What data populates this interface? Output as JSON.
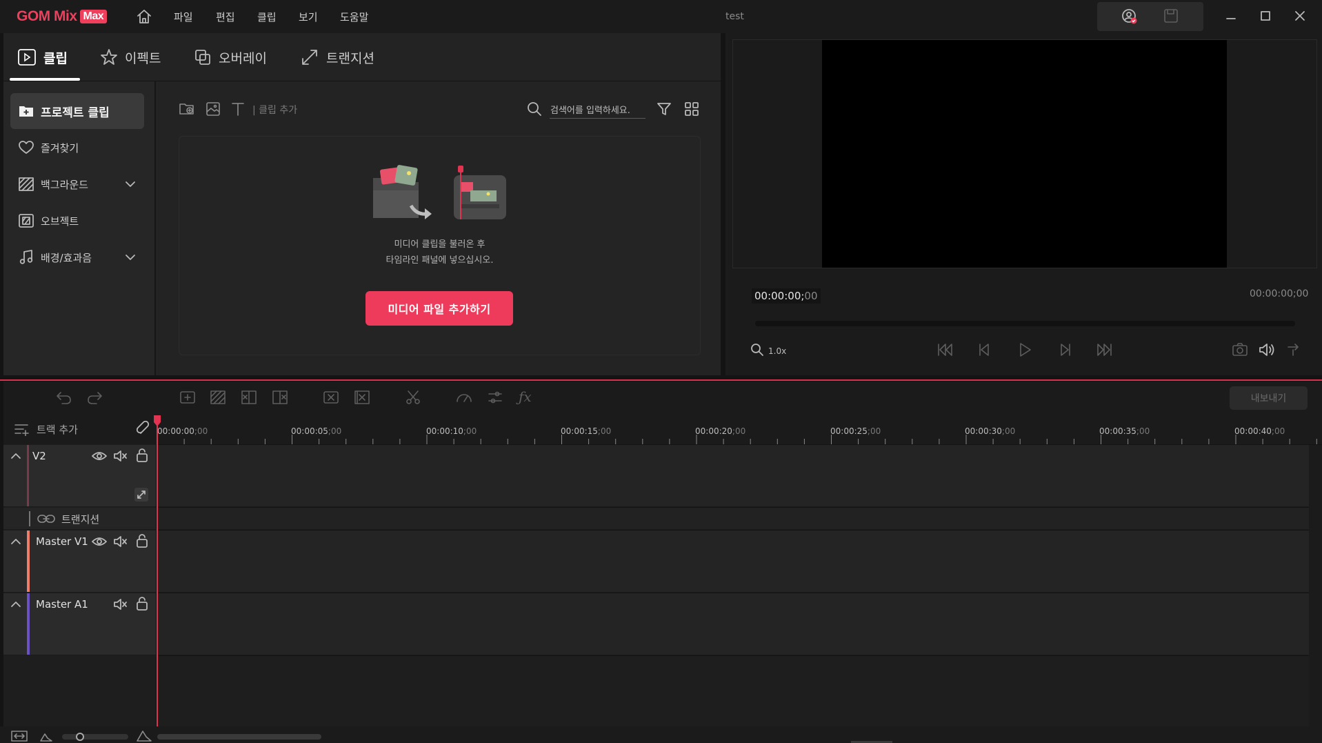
{
  "app": {
    "logo_text": "GOM Mix",
    "logo_badge": "Max",
    "document_title": "test",
    "brand_color": "#ee3f5c"
  },
  "menu": [
    "파일",
    "편집",
    "클립",
    "보기",
    "도움말"
  ],
  "tabs": [
    {
      "label": "클립",
      "icon": "clip-icon",
      "active": true
    },
    {
      "label": "이펙트",
      "icon": "star-icon"
    },
    {
      "label": "오버레이",
      "icon": "overlay-icon"
    },
    {
      "label": "트랜지션",
      "icon": "transition-icon"
    }
  ],
  "sidebar": {
    "items": [
      {
        "label": "프로젝트 클립",
        "icon": "folder-plus-icon",
        "active": true
      },
      {
        "label": "즐겨찾기",
        "icon": "heart-icon"
      },
      {
        "label": "백그라운드",
        "icon": "background-icon",
        "expandable": true
      },
      {
        "label": "오브젝트",
        "icon": "object-icon"
      },
      {
        "label": "배경/효과음",
        "icon": "music-note-icon",
        "expandable": true
      }
    ]
  },
  "media": {
    "clip_add_label": "| 클립 추가",
    "search_placeholder": "검색어를 입력하세요.",
    "hint_line1": "미디어 클립을 불러온 후",
    "hint_line2": "타임라인 패널에 넣으십시오.",
    "add_button": "미디어 파일 추가하기"
  },
  "preview": {
    "current_time": "00:00:00;",
    "current_frames": "00",
    "total_time": "00:00:00;00",
    "zoom": "1.0x",
    "progress": 0
  },
  "timeline": {
    "export_button": "내보내기",
    "add_track_label": "트랙 추가",
    "ruler_ticks": [
      {
        "main": "00:00:00",
        "sub": ";00"
      },
      {
        "main": "00:00:05",
        "sub": ";00"
      },
      {
        "main": "00:00:10",
        "sub": ";00"
      },
      {
        "main": "00:00:15",
        "sub": ";00"
      },
      {
        "main": "00:00:20",
        "sub": ";00"
      },
      {
        "main": "00:00:25",
        "sub": ";00"
      },
      {
        "main": "00:00:30",
        "sub": ";00"
      },
      {
        "main": "00:00:35",
        "sub": ";00"
      },
      {
        "main": "00:00:40",
        "sub": ";00"
      }
    ],
    "tracks": [
      {
        "name": "V2",
        "color": "#7a3a4a"
      },
      {
        "name": "Master V1",
        "color": "#f07d6a"
      },
      {
        "name": "Master A1",
        "color": "#6a52c4"
      }
    ],
    "transition_label": "트랜지션"
  }
}
